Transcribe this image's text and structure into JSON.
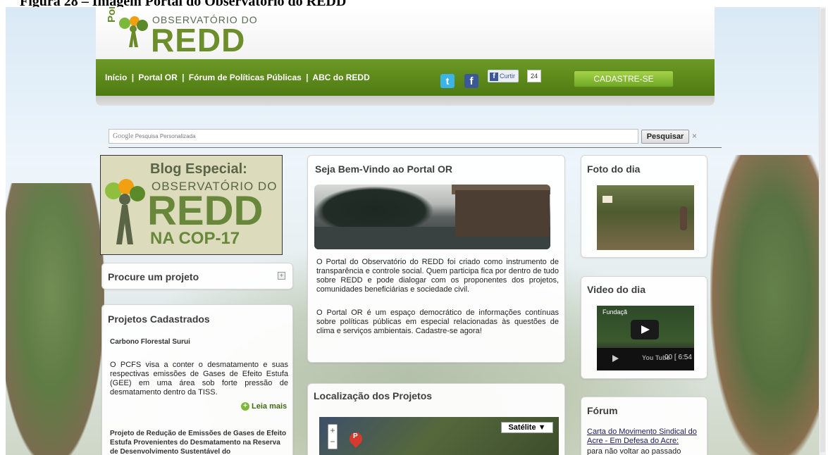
{
  "caption": "Figura 28 – Imagem Portal do Observatório do REDD",
  "header": {
    "logo_portal": "Portal",
    "logo_small": "OBSERVATÓRIO DO",
    "logo_big": "REDD"
  },
  "nav": {
    "links": [
      "Início",
      "Portal OR",
      "Fórum de Políticas Públicas",
      "ABC do REDD"
    ],
    "separator": "|",
    "twitter_glyph": "t",
    "facebook_glyph": "f",
    "like_label": "Curtir",
    "like_count": "24",
    "signup_label": "CADASTRE-SE"
  },
  "search": {
    "brand": "Google",
    "placeholder": "Pesquisa Personalizada",
    "button": "Pesquisar",
    "clear": "×"
  },
  "banner": {
    "line1": "Blog Especial:",
    "line2": "OBSERVATÓRIO DO",
    "line3": "REDD",
    "line4": "NA COP-17"
  },
  "project_search": {
    "title": "Procure um projeto",
    "expand": "+"
  },
  "projects": {
    "title": "Projetos Cadastrados",
    "item1_name": "Carbono Florestal Surui",
    "item1_desc": "O PCFS visa a conter o desmatamento e suas respectivas emissões de Gases de Efeito Estufa (GEE) em uma área sob forte pressão de desmatamento dentro da TISS.",
    "read_more": "Leia mais",
    "item2_name": "Projeto de Redução de Emissões de Gases de Efeito Estufa Provenientes do Desmatamento na Reserva de Desenvolvimento Sustentável do"
  },
  "welcome": {
    "title": "Seja Bem-Vindo ao Portal OR",
    "paragraph1": "O Portal do Observatório do REDD foi criado como instrumento de transparência e controle social. Quem participa fica por dentro de tudo sobre REDD e pode dialogar com os proponentes dos projetos, comunidades beneficiárias e sociedade civil.",
    "paragraph2": "O Portal OR é um espaço democrático de informações contínuas sobre políticas públicas em especial relacionadas às questões de clima e serviços ambientais. Cadastre-se agora!"
  },
  "map_panel": {
    "title": "Localização dos Projetos",
    "zoom_in": "+",
    "zoom_out": "−",
    "pin_label": "P",
    "satellite": "Satélite ▼"
  },
  "photo": {
    "title": "Foto do dia"
  },
  "video": {
    "title": "Video do dia",
    "video_title": "Fundaçã",
    "youtube": "You Tube",
    "time": "00 [ 6:54"
  },
  "forum": {
    "title": "Fórum",
    "link": "Carta do Movimento Sindical do Acre - Em Defesa do Acre:",
    "tail": "para não voltar ao passado"
  }
}
